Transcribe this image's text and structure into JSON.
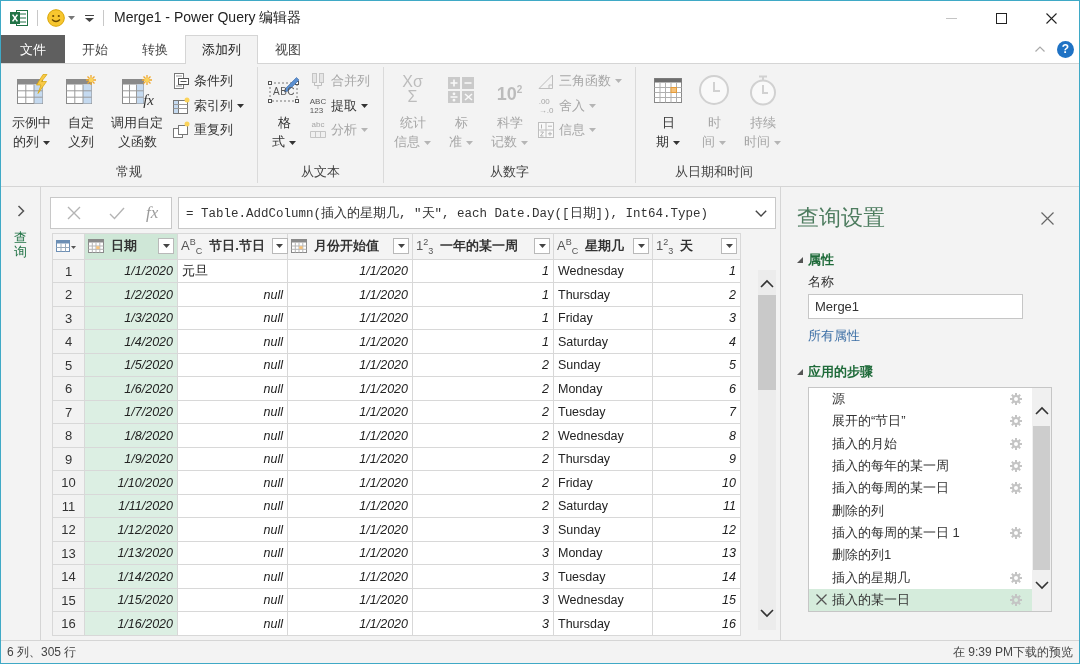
{
  "window": {
    "title": "Merge1 - Power Query 编辑器"
  },
  "tabs": [
    {
      "label": "文件",
      "kind": "file",
      "selected": false
    },
    {
      "label": "开始",
      "kind": "tab",
      "selected": false
    },
    {
      "label": "转换",
      "kind": "tab",
      "selected": false
    },
    {
      "label": "添加列",
      "kind": "tab",
      "selected": true
    },
    {
      "label": "视图",
      "kind": "tab",
      "selected": false
    }
  ],
  "help_button": {
    "label": "?"
  },
  "ribbon": {
    "groups": [
      {
        "label": "常规",
        "large_buttons": [
          {
            "label_lines": [
              "示例中",
              "的列"
            ],
            "dropdown": true,
            "disabled": false
          },
          {
            "label_lines": [
              "自定",
              "义列"
            ],
            "dropdown": false,
            "disabled": false
          },
          {
            "label_lines": [
              "调用自定",
              "义函数"
            ],
            "dropdown": false,
            "disabled": false,
            "icon_text": "fx"
          }
        ],
        "small_buttons": [
          {
            "label": "条件列",
            "dropdown": false,
            "disabled": false
          },
          {
            "label": "索引列",
            "dropdown": true,
            "disabled": false
          },
          {
            "label": "重复列",
            "dropdown": false,
            "disabled": false
          }
        ]
      },
      {
        "label": "从文本",
        "large_buttons": [
          {
            "label_lines": [
              "格",
              "式"
            ],
            "dropdown": true,
            "disabled": false,
            "icon_text": "ABC"
          }
        ],
        "small_buttons": [
          {
            "label": "合并列",
            "dropdown": false,
            "disabled": true
          },
          {
            "label": "提取",
            "dropdown": true,
            "disabled": false,
            "icon_text": "ABC 123"
          },
          {
            "label": "分析",
            "dropdown": true,
            "disabled": true,
            "icon_text": "abc"
          }
        ]
      },
      {
        "label": "从数字",
        "large_buttons": [
          {
            "label_lines": [
              "统计",
              "信息"
            ],
            "dropdown": true,
            "disabled": true,
            "icon_text": "Xσ Σ"
          },
          {
            "label_lines": [
              "标",
              "准"
            ],
            "dropdown": true,
            "disabled": true
          },
          {
            "label_lines": [
              "科学",
              "记数"
            ],
            "dropdown": true,
            "disabled": true,
            "icon_text": "10$^{2}$"
          }
        ],
        "small_buttons": [
          {
            "label": "三角函数",
            "dropdown": true,
            "disabled": true
          },
          {
            "label": "舍入",
            "dropdown": true,
            "disabled": true,
            "icon_text": ".00 →.0"
          },
          {
            "label": "信息",
            "dropdown": true,
            "disabled": true
          }
        ]
      },
      {
        "label": "从日期和时间",
        "large_buttons": [
          {
            "label_lines": [
              "日",
              "期"
            ],
            "dropdown": true,
            "disabled": false
          },
          {
            "label_lines": [
              "时",
              "间"
            ],
            "dropdown": true,
            "disabled": true
          },
          {
            "label_lines": [
              "持续",
              "时间"
            ],
            "dropdown": true,
            "disabled": true
          }
        ]
      }
    ]
  },
  "queries_pane": {
    "label": "查询"
  },
  "formula_bar": {
    "fx_label": "fx",
    "formula": "= Table.AddColumn(插入的星期几, \"天\", each Date.Day([日期]), Int64.Type)"
  },
  "table": {
    "columns": [
      {
        "name": "日期",
        "kind": "date",
        "selected": true
      },
      {
        "name": "节日.节日",
        "kind": "text",
        "type_label": "A$^{B}$$_{C}$",
        "selected": false
      },
      {
        "name": "月份开始值",
        "kind": "date",
        "selected": false
      },
      {
        "name": "一年的某一周",
        "kind": "number",
        "type_label": "1$^{2}$$_{3}$",
        "selected": false
      },
      {
        "name": "星期几",
        "kind": "text",
        "type_label": "A$^{B}$$_{C}$",
        "selected": false
      },
      {
        "name": "天",
        "kind": "number",
        "type_label": "1$^{2}$$_{3}$",
        "selected": false
      }
    ],
    "rows": [
      {
        "number": "1",
        "cells": [
          "1/1/2020",
          "元旦",
          "1/1/2020",
          "1",
          "Wednesday",
          "1"
        ]
      },
      {
        "number": "2",
        "cells": [
          "1/2/2020",
          {
            "text": "null",
            "kind": "null"
          },
          "1/1/2020",
          "1",
          "Thursday",
          "2"
        ]
      },
      {
        "number": "3",
        "cells": [
          "1/3/2020",
          {
            "text": "null",
            "kind": "null"
          },
          "1/1/2020",
          "1",
          "Friday",
          "3"
        ]
      },
      {
        "number": "4",
        "cells": [
          "1/4/2020",
          {
            "text": "null",
            "kind": "null"
          },
          "1/1/2020",
          "1",
          "Saturday",
          "4"
        ]
      },
      {
        "number": "5",
        "cells": [
          "1/5/2020",
          {
            "text": "null",
            "kind": "null"
          },
          "1/1/2020",
          "2",
          "Sunday",
          "5"
        ]
      },
      {
        "number": "6",
        "cells": [
          "1/6/2020",
          {
            "text": "null",
            "kind": "null"
          },
          "1/1/2020",
          "2",
          "Monday",
          "6"
        ]
      },
      {
        "number": "7",
        "cells": [
          "1/7/2020",
          {
            "text": "null",
            "kind": "null"
          },
          "1/1/2020",
          "2",
          "Tuesday",
          "7"
        ]
      },
      {
        "number": "8",
        "cells": [
          "1/8/2020",
          {
            "text": "null",
            "kind": "null"
          },
          "1/1/2020",
          "2",
          "Wednesday",
          "8"
        ]
      },
      {
        "number": "9",
        "cells": [
          "1/9/2020",
          {
            "text": "null",
            "kind": "null"
          },
          "1/1/2020",
          "2",
          "Thursday",
          "9"
        ]
      },
      {
        "number": "10",
        "cells": [
          "1/10/2020",
          {
            "text": "null",
            "kind": "null"
          },
          "1/1/2020",
          "2",
          "Friday",
          "10"
        ]
      },
      {
        "number": "11",
        "cells": [
          "1/11/2020",
          {
            "text": "null",
            "kind": "null"
          },
          "1/1/2020",
          "2",
          "Saturday",
          "11"
        ]
      },
      {
        "number": "12",
        "cells": [
          "1/12/2020",
          {
            "text": "null",
            "kind": "null"
          },
          "1/1/2020",
          "3",
          "Sunday",
          "12"
        ]
      },
      {
        "number": "13",
        "cells": [
          "1/13/2020",
          {
            "text": "null",
            "kind": "null"
          },
          "1/1/2020",
          "3",
          "Monday",
          "13"
        ]
      },
      {
        "number": "14",
        "cells": [
          "1/14/2020",
          {
            "text": "null",
            "kind": "null"
          },
          "1/1/2020",
          "3",
          "Tuesday",
          "14"
        ]
      },
      {
        "number": "15",
        "cells": [
          "1/15/2020",
          {
            "text": "null",
            "kind": "null"
          },
          "1/1/2020",
          "3",
          "Wednesday",
          "15"
        ]
      },
      {
        "number": "16",
        "cells": [
          "1/16/2020",
          {
            "text": "null",
            "kind": "null"
          },
          "1/1/2020",
          "3",
          "Thursday",
          "16"
        ]
      }
    ]
  },
  "query_settings": {
    "title": "查询设置",
    "properties": {
      "heading": "属性",
      "expanded": true,
      "name_label": "名称",
      "name_value": "Merge1",
      "all_properties_link": "所有属性"
    },
    "applied_steps": {
      "heading": "应用的步骤",
      "expanded": true,
      "steps": [
        {
          "label": "源",
          "settings": true,
          "selected": false
        },
        {
          "label": "展开的“节日”",
          "settings": true,
          "selected": false
        },
        {
          "label": "插入的月始",
          "settings": true,
          "selected": false
        },
        {
          "label": "插入的每年的某一周",
          "settings": true,
          "selected": false
        },
        {
          "label": "插入的每周的某一日",
          "settings": true,
          "selected": false
        },
        {
          "label": "删除的列",
          "settings": false,
          "selected": false
        },
        {
          "label": "插入的每周的某一日 1",
          "settings": true,
          "selected": false
        },
        {
          "label": "删除的列1",
          "settings": false,
          "selected": false
        },
        {
          "label": "插入的星期几",
          "settings": true,
          "selected": false
        },
        {
          "label": "插入的某一日",
          "settings": true,
          "selected": true
        }
      ]
    }
  },
  "status_bar": {
    "left": "6 列、305 行",
    "right": "在 9:39 PM下载的预览"
  }
}
